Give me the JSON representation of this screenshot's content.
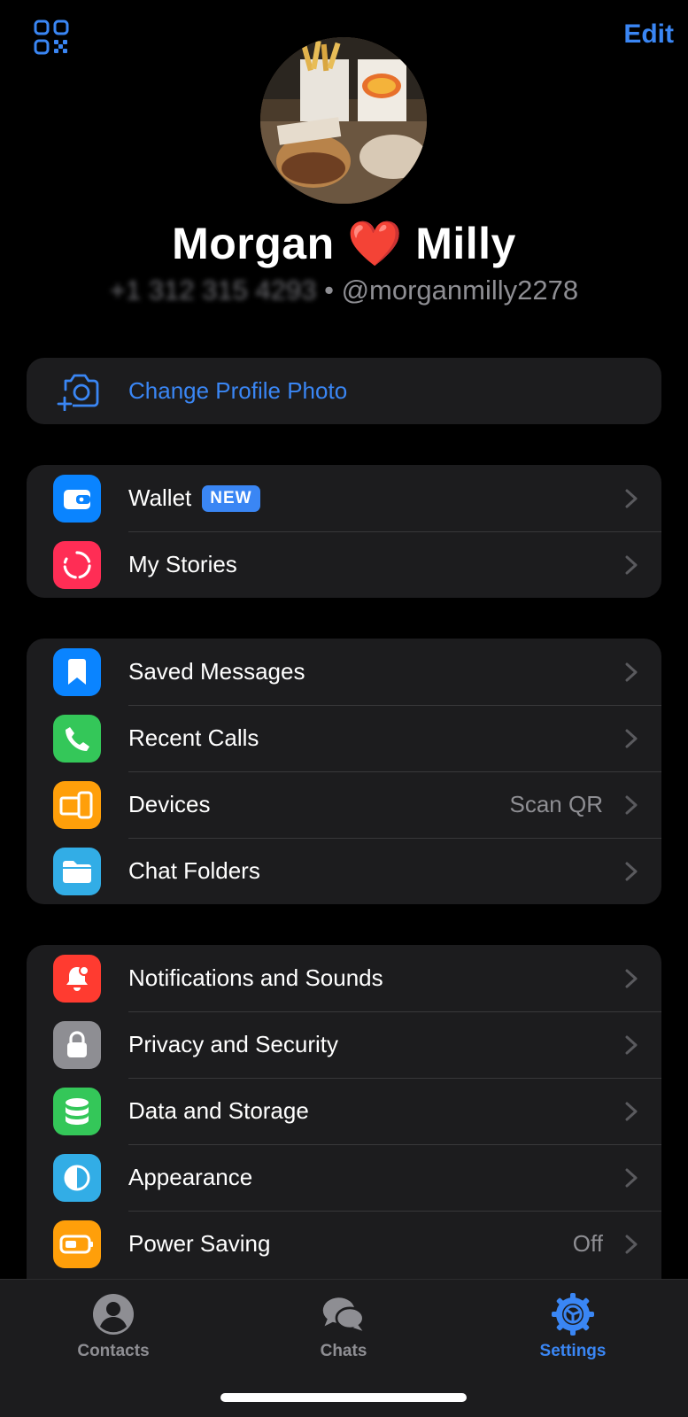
{
  "header": {
    "edit_label": "Edit",
    "qr_icon": "qr-code-icon"
  },
  "profile": {
    "name_first": "Morgan",
    "heart": "❤️",
    "name_last": "Milly",
    "phone_blurred": "+1 312 315 4293",
    "separator": " • ",
    "username": "@morganmilly2278"
  },
  "change_photo": {
    "label": "Change Profile Photo",
    "icon": "camera-add-icon"
  },
  "groups": {
    "wallet": {
      "label": "Wallet",
      "badge": "NEW",
      "color": "#0a84ff",
      "icon": "wallet-icon"
    },
    "stories": {
      "label": "My Stories",
      "color": "#ff2d55",
      "icon": "stories-icon"
    },
    "saved": {
      "label": "Saved Messages",
      "color": "#0a84ff",
      "icon": "bookmark-icon"
    },
    "calls": {
      "label": "Recent Calls",
      "color": "#34c759",
      "icon": "phone-icon"
    },
    "devices": {
      "label": "Devices",
      "value": "Scan QR",
      "color": "#ff9f0a",
      "icon": "devices-icon"
    },
    "folders": {
      "label": "Chat Folders",
      "color": "#32ade6",
      "icon": "folder-icon"
    },
    "notifications": {
      "label": "Notifications and Sounds",
      "color": "#ff3b30",
      "icon": "bell-icon"
    },
    "privacy": {
      "label": "Privacy and Security",
      "color": "#8e8e93",
      "icon": "lock-icon"
    },
    "data": {
      "label": "Data and Storage",
      "color": "#34c759",
      "icon": "database-icon"
    },
    "appearance": {
      "label": "Appearance",
      "color": "#32ade6",
      "icon": "contrast-icon"
    },
    "power": {
      "label": "Power Saving",
      "value": "Off",
      "color": "#ff9f0a",
      "icon": "battery-icon"
    }
  },
  "tabbar": {
    "contacts": "Contacts",
    "chats": "Chats",
    "settings": "Settings",
    "active": "Settings"
  }
}
